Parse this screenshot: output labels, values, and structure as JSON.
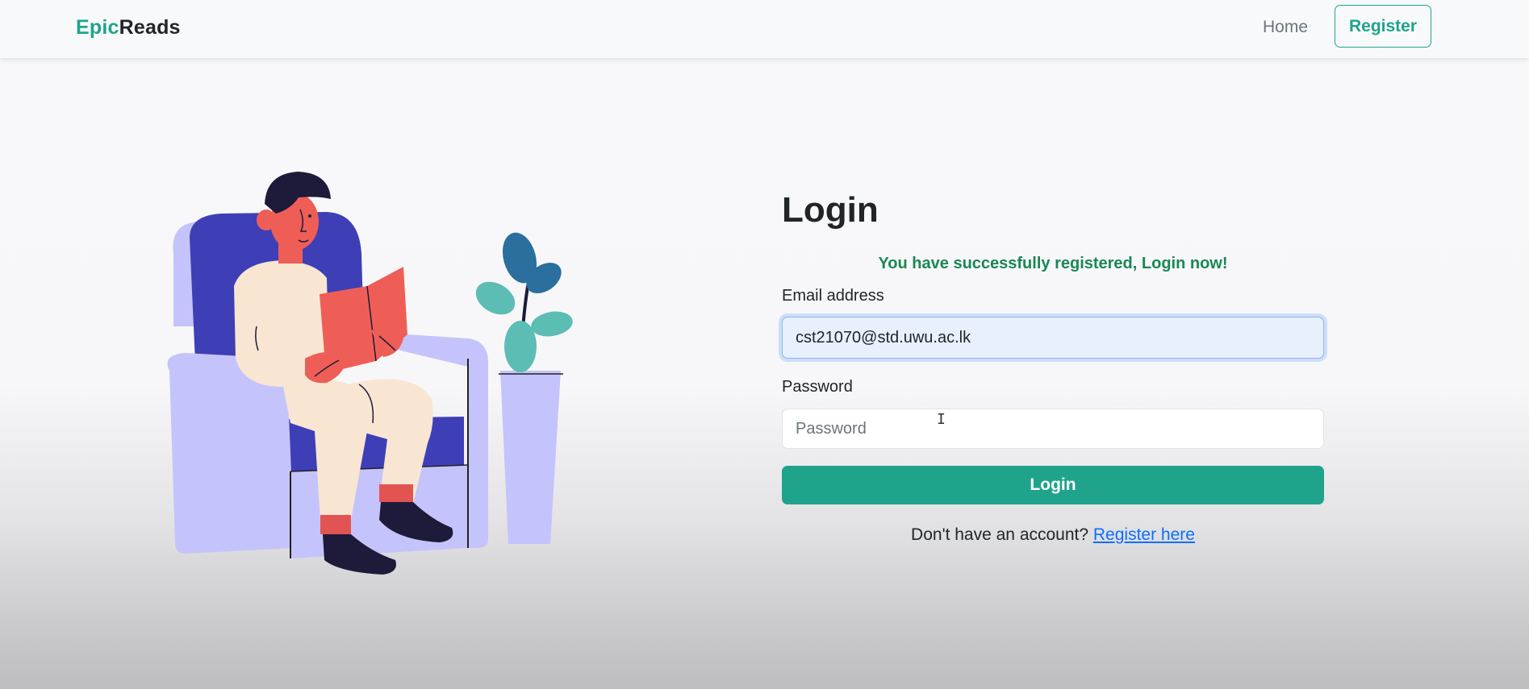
{
  "navbar": {
    "brand_part1": "Epic",
    "brand_part2": "Reads",
    "home_label": "Home",
    "register_label": "Register"
  },
  "illustration": {
    "icon": "person-reading-in-armchair-illustration"
  },
  "login": {
    "title": "Login",
    "success_message": "You have successfully registered, Login now!",
    "email_label": "Email address",
    "email_value": "cst21070@std.uwu.ac.lk",
    "password_label": "Password",
    "password_placeholder": "Password",
    "password_value": "",
    "submit_label": "Login",
    "register_prompt": "Don't have an account?",
    "register_link": "Register here"
  },
  "colors": {
    "accent": "#20a38b",
    "success": "#198754",
    "link": "#0d6efd",
    "text": "#212529"
  }
}
